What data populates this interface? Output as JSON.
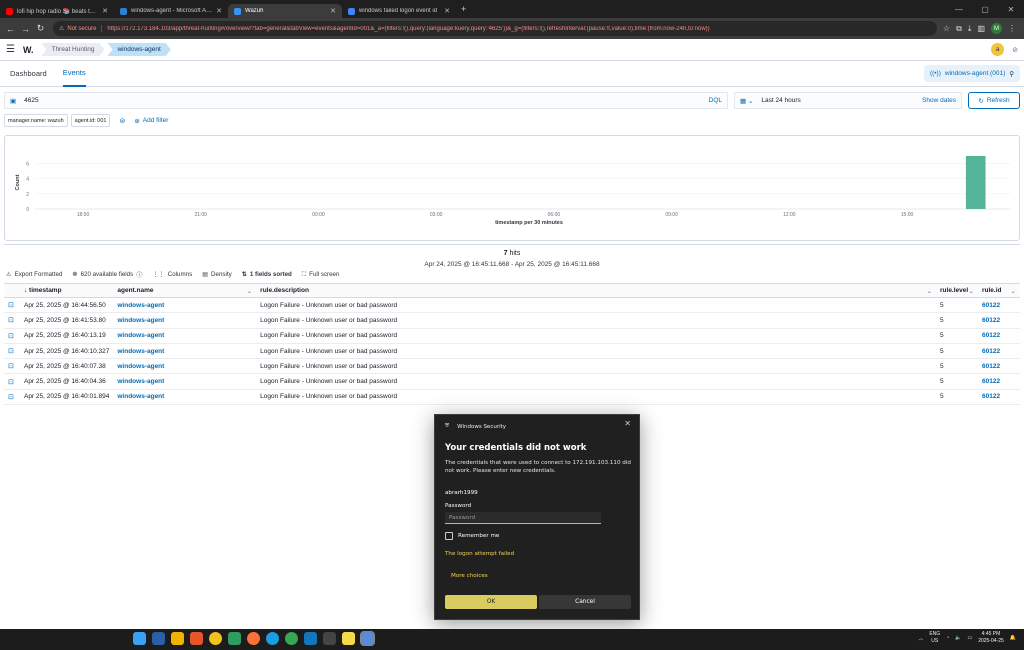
{
  "browser": {
    "tabs": [
      {
        "title": "lofi hip hop radio 📚 beats to relax/study to",
        "active": false,
        "color": "#ff0000"
      },
      {
        "title": "windows-agent - Microsoft Azure",
        "active": false,
        "color": "#2f7fd6"
      },
      {
        "title": "Wazuh",
        "active": true,
        "color": "#3595f6"
      },
      {
        "title": "windows failed logon event id",
        "active": false,
        "color": "#4285f4"
      }
    ],
    "not_secure": "Not secure",
    "url": "https://172.173.184.103/app/threat-hunting#/overview/?tab=general&tabView=events&agentId=001&_a=(filters:!(),query:(language:kuery,query:'4625'))&_g=(filters:!(),refreshInterval:(pause:!t,value:0),time:(from:now-24h,to:now))",
    "profile_initial": "M"
  },
  "header": {
    "logo": "W.",
    "breadcrumbs": [
      "Threat Hunting",
      "windows-agent"
    ],
    "avatar_initial": "a"
  },
  "tabs": {
    "dashboard": "Dashboard",
    "events": "Events",
    "agent_pill": "windows-agent (001)"
  },
  "search": {
    "query": "4625",
    "language": "DQL",
    "time_range": "Last 24 hours",
    "show_dates": "Show dates",
    "refresh": "Refresh"
  },
  "filters": {
    "pills": [
      "manager.name: wazuh",
      "agent.id: 001"
    ],
    "add_filter": "Add filter"
  },
  "chart_data": {
    "type": "bar",
    "xlabel": "timestamp per 30 minutes",
    "ylabel": "Count",
    "x_ticks": [
      "18:00",
      "21:00",
      "00:00",
      "03:00",
      "06:00",
      "09:00",
      "12:00",
      "15:00"
    ],
    "y_ticks": [
      0,
      2,
      4,
      6
    ],
    "ylim": [
      0,
      7
    ],
    "bars": [
      {
        "x": "16:30",
        "value": 7
      }
    ],
    "color": "#54b399"
  },
  "results": {
    "hits_count": "7",
    "hits_label": "hits",
    "range": "Apr 24, 2025 @ 16:45:11.668 - Apr 25, 2025 @ 16:45:11.668",
    "toolbar": {
      "export": "Export Formatted",
      "fields": "620 available fields",
      "columns": "Columns",
      "density": "Density",
      "sorted": "1 fields sorted",
      "fullscreen": "Full screen"
    },
    "columns": [
      "timestamp",
      "agent.name",
      "rule.description",
      "rule.level",
      "rule.id"
    ],
    "rows": [
      {
        "timestamp": "Apr 25, 2025 @ 16:44:56.50",
        "agent": "windows-agent",
        "description": "Logon Failure - Unknown user or bad password",
        "level": "5",
        "id": "60122"
      },
      {
        "timestamp": "Apr 25, 2025 @ 16:41:53.80",
        "agent": "windows-agent",
        "description": "Logon Failure - Unknown user or bad password",
        "level": "5",
        "id": "60122"
      },
      {
        "timestamp": "Apr 25, 2025 @ 16:40:13.19",
        "agent": "windows-agent",
        "description": "Logon Failure - Unknown user or bad password",
        "level": "5",
        "id": "60122"
      },
      {
        "timestamp": "Apr 25, 2025 @ 16:40:10.327",
        "agent": "windows-agent",
        "description": "Logon Failure - Unknown user or bad password",
        "level": "5",
        "id": "60122"
      },
      {
        "timestamp": "Apr 25, 2025 @ 16:40:07.38",
        "agent": "windows-agent",
        "description": "Logon Failure - Unknown user or bad password",
        "level": "5",
        "id": "60122"
      },
      {
        "timestamp": "Apr 25, 2025 @ 16:40:04.36",
        "agent": "windows-agent",
        "description": "Logon Failure - Unknown user or bad password",
        "level": "5",
        "id": "60122"
      },
      {
        "timestamp": "Apr 25, 2025 @ 16:40:01.894",
        "agent": "windows-agent",
        "description": "Logon Failure - Unknown user or bad password",
        "level": "5",
        "id": "60122"
      }
    ]
  },
  "dialog": {
    "app": "Windows Security",
    "title": "Your credentials did not work",
    "message": "The credentials that were used to connect to 172.191.103.110 did not work. Please enter new credentials.",
    "username": "abrarh1999",
    "password_label": "Password",
    "password_placeholder": "Password",
    "remember": "Remember me",
    "error": "The logon attempt failed",
    "more": "More choices",
    "ok": "OK",
    "cancel": "Cancel"
  },
  "taskbar": {
    "lang": [
      "ENG",
      "US"
    ],
    "time": "4:45 PM",
    "date": "2025-04-25"
  }
}
